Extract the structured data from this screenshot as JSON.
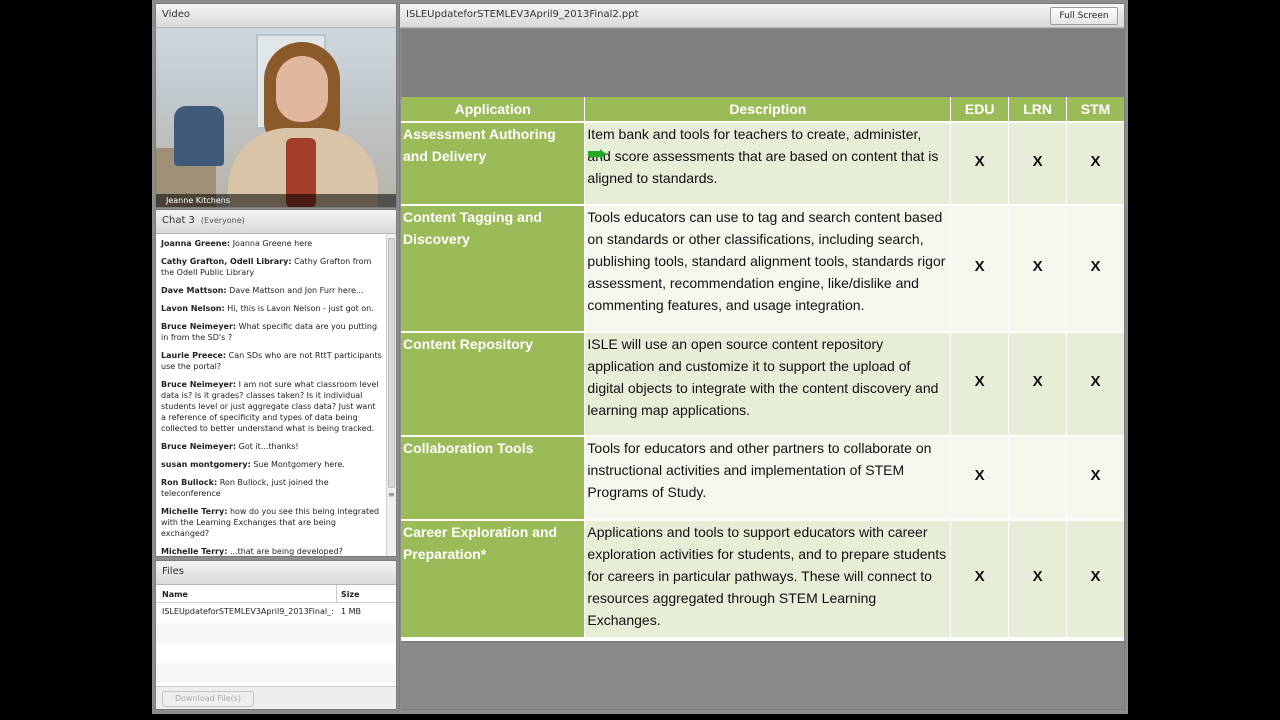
{
  "video": {
    "title": "Video",
    "participant_name": "Jeanne Kitchens"
  },
  "chat": {
    "title": "Chat 3",
    "audience": "(Everyone)",
    "messages": [
      {
        "sender": "Joanna Greene:",
        "text": "Joanna Greene here"
      },
      {
        "sender": "Cathy Grafton, Odell Library:",
        "text": "Cathy Grafton from the Odell Public Library"
      },
      {
        "sender": "Dave Mattson:",
        "text": "Dave Mattson and Jon Furr here..."
      },
      {
        "sender": "Lavon Nelson:",
        "text": "Hi, this is Lavon Nelson - just got on."
      },
      {
        "sender": "Bruce Neimeyer:",
        "text": "What specific data are you putting in from the SD's ?"
      },
      {
        "sender": "Laurie Preece:",
        "text": "Can SDs who are not RttT participants use the portal?"
      },
      {
        "sender": "Bruce Neimeyer:",
        "text": "I am not sure what classroom level data is? Is it grades? classes taken? Is it individual students level or just aggregate class data? Just want a reference of specificity and types of data being collected to better understand what is being tracked."
      },
      {
        "sender": "Bruce Neimeyer:",
        "text": "Got it...thanks!"
      },
      {
        "sender": "susan montgomery:",
        "text": "Sue Montgomery here."
      },
      {
        "sender": "Ron Bullock:",
        "text": "Ron Bullock, just joined the teleconference"
      },
      {
        "sender": "Michelle Terry:",
        "text": "how do you see this being integrated with the Learning Exchanges that are being exchanged?"
      },
      {
        "sender": "Michelle Terry:",
        "text": "...that are being developed?"
      }
    ]
  },
  "files": {
    "title": "Files",
    "col_name": "Name",
    "col_size": "Size",
    "rows": [
      {
        "name": "ISLEUpdateforSTEMLEV3April9_2013Final_:",
        "size": "1 MB"
      }
    ],
    "download_label": "Download File(s)"
  },
  "share": {
    "title": "ISLEUpdateforSTEMLEV3April9_2013Final2.ppt",
    "fullscreen_label": "Full Screen",
    "table": {
      "headers": [
        "Application",
        "Description",
        "EDU",
        "LRN",
        "STM"
      ],
      "rows": [
        {
          "application": "Assessment Authoring and Delivery",
          "description": "Item bank and tools for teachers to create, administer, and score assessments that are based on content that is aligned to standards.",
          "edu": "X",
          "lrn": "X",
          "stm": "X"
        },
        {
          "application": "Content Tagging and Discovery",
          "description": "Tools educators can use to tag and search content based on standards or other classifications, including search, publishing tools, standard alignment tools, standards rigor assessment, recommendation engine, like/dislike and commenting features, and usage integration.",
          "edu": "X",
          "lrn": "X",
          "stm": "X"
        },
        {
          "application": "Content Repository",
          "description": "ISLE will use an open source content repository application and customize it to support the upload of digital objects to integrate with the content discovery and learning map applications.",
          "edu": "X",
          "lrn": "X",
          "stm": "X"
        },
        {
          "application": "Collaboration Tools",
          "description": "Tools for educators and other partners to collaborate on instructional activities and implementation of STEM Programs of Study.",
          "edu": "X",
          "lrn": "",
          "stm": "X"
        },
        {
          "application": "Career Exploration and Preparation*",
          "description": "Applications and tools to support educators with career exploration activities for students, and to prepare students for careers in particular pathways.  These will connect to resources aggregated through STEM Learning Exchanges.",
          "edu": "X",
          "lrn": "X",
          "stm": "X"
        }
      ]
    }
  },
  "colors": {
    "slide_green": "#9bbb59",
    "row_light": "#e6eed7",
    "row_lighter": "#f3f7ed",
    "pointer_green": "#22aa22"
  }
}
